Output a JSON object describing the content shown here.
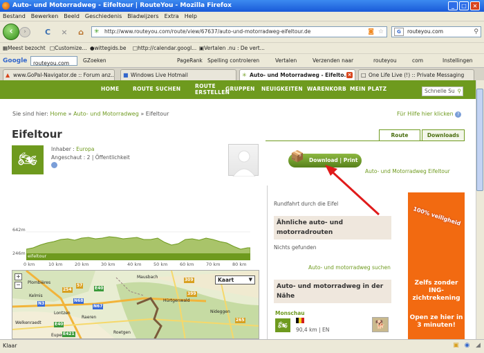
{
  "window": {
    "title": "Auto- und Motorradweg - Eifeltour | RouteYou - Mozilla Firefox",
    "min": "_",
    "max": "□",
    "close": "×"
  },
  "menu": [
    "Bestand",
    "Bewerken",
    "Beeld",
    "Geschiedenis",
    "Bladwijzers",
    "Extra",
    "Help"
  ],
  "nav": {
    "back": "‹",
    "forward": "›",
    "reload": "C",
    "stop": "×",
    "home": "⌂",
    "url": "http://www.routeyou.com/route/view/67637/auto-und-motorradweg-eifeltour.de",
    "search_value": "routeyou.com"
  },
  "bookmarks": [
    "Meest bezocht",
    "Customize...",
    "wittegids.be",
    "http://calendar.googl...",
    "Vertalen .nu : De vert..."
  ],
  "googlebar": {
    "logo": "Google",
    "search_value": "routeyou.com",
    "zoeken": "Zoeken",
    "pagerank": "PageRank",
    "spelling": "Spelling controleren",
    "vertalen": "Vertalen",
    "verzenden": "Verzenden naar",
    "routeyou": "routeyou",
    "com": "com",
    "instellingen": "Instellingen"
  },
  "tabs": [
    {
      "label": "www.GoPal-Navigator.de :: Forum anz..."
    },
    {
      "label": "Windows Live Hotmail"
    },
    {
      "label": "Auto- und Motorradweg - Eifelto..."
    },
    {
      "label": "One Life Live (!) :: Private Messaging"
    }
  ],
  "sitenav": {
    "items": [
      "HOME",
      "ROUTE SUCHEN",
      "ROUTE",
      "ERSTELLEN",
      "GRUPPEN",
      "NEUIGKEITEN",
      "WARENKORB",
      "MEIN PLATZ"
    ],
    "quick_placeholder": "Schnelle Su"
  },
  "breadcrumb": {
    "prefix": "Sie sind hier:",
    "home": "Home",
    "sep1": "»",
    "cat": "Auto- und Motorradweg",
    "sep2": "»",
    "current": "Eifeltour"
  },
  "help_link": "Für Hilfe hier klicken",
  "page_title": "Eifeltour",
  "route_tabs": {
    "route": "Route",
    "downloads": "Downloads"
  },
  "owner": {
    "label": "Inhaber :",
    "name": "Europa",
    "views_label": "Angeschaut :",
    "views": "2",
    "sep": "|",
    "visibility": "Öffentlichkeit"
  },
  "download": {
    "label": "Download | Print",
    "sub": "Auto- und Motorradweg Eifeltour"
  },
  "elevation": {
    "y_max": "642m",
    "y_min": "246m",
    "tag": "eifeltour",
    "ticks": [
      "0 km",
      "10 km",
      "20 km",
      "30 km",
      "40 km",
      "50 km",
      "60 km",
      "70 km",
      "80 km"
    ]
  },
  "map": {
    "select": "Kaart",
    "zoom_in": "+",
    "zoom_out": "−",
    "cities": [
      "Plombières",
      "Kelmis",
      "Lontzen",
      "Welkenraedt",
      "Raeren",
      "Roetgen",
      "Hürtgenwald",
      "Nideggen",
      "Mausbach",
      "Eupen"
    ],
    "roads": [
      "254",
      "57",
      "E40",
      "N3",
      "N68",
      "N67",
      "E40",
      "E421",
      "309",
      "399",
      "265"
    ]
  },
  "side": {
    "rundfahrt": "Rundfahrt durch die Eifel",
    "similar_title": "Ähnliche auto- und motorradrouten",
    "nothing": "Nichts gefunden",
    "more_link": "Auto- und motorradweg suchen",
    "near_title": "Auto- und motorradweg in der Nähe",
    "near_item": "Monschau",
    "near_dist": "90,4 km",
    "near_lang": "EN"
  },
  "ad": {
    "badge": "100% veiligheid",
    "t1": "Zelfs zonder ING-zichtrekening",
    "t2": "Open ze hier in 3 minuten!"
  },
  "status": "Klaar",
  "colors": {
    "brand_green": "#6e9a1e",
    "ad_orange": "#f26a11",
    "arrow_red": "#e01b1b"
  }
}
